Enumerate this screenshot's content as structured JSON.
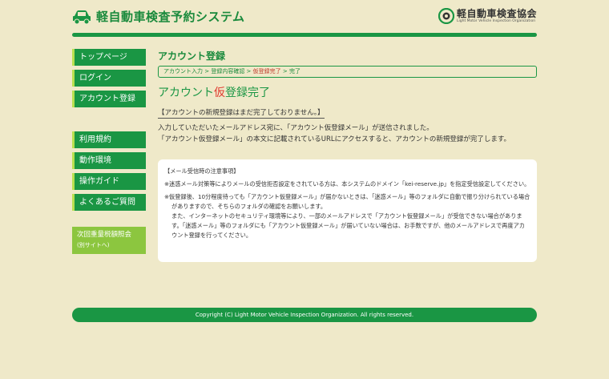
{
  "header": {
    "site_title": "軽自動車検査予約システム",
    "org_name": "軽自動車検査協会",
    "org_sub": "Light Motor Vehicle Inspection Organization"
  },
  "sidebar": {
    "primary": [
      {
        "label": "トップページ"
      },
      {
        "label": "ログイン"
      },
      {
        "label": "アカウント登録"
      }
    ],
    "secondary": [
      {
        "label": "利用規約"
      },
      {
        "label": "動作環境"
      },
      {
        "label": "操作ガイド"
      },
      {
        "label": "よくあるご質問"
      }
    ],
    "tax_link": {
      "label": "次回重量税額照会",
      "sub": "(別サイトへ)"
    }
  },
  "main": {
    "page_title": "アカウント登録",
    "breadcrumb": {
      "step1": "アカウント入力",
      "step2": "登録内容確認",
      "step3": "仮登録完了",
      "step4": "完了",
      "separator": " > "
    },
    "status_heading": {
      "pre": "アカウント",
      "kari": "仮",
      "post": "登録完了"
    },
    "notice": "【アカウントの新規登録はまだ完了しておりません。】",
    "body_line1": "入力していただいたメールアドレス宛に、「アカウント仮登録メール」が送信されました。",
    "body_line2": "「アカウント仮登録メール」の本文に記載されているURLにアクセスすると、アカウントの新規登録が完了します。",
    "info_box": {
      "title": "【メール受信時の注意事項】",
      "para1": "※迷惑メール対策等によりメールの受信拒否設定をされている方は、本システムのドメイン「kei-reserve.jp」を指定受信設定してください。",
      "para2": "※仮登録後、10分程度待っても「アカウント仮登録メール」が届かないときは、「迷惑メール」等のフォルダに自動で振り分けられている場合がありますので、そちらのフォルダの確認をお願いします。",
      "para3": "また、インターネットのセキュリティ環境等により、一部のメールアドレスで「アカウント仮登録メール」が受信できない場合があります。「迷惑メール」等のフォルダにも「アカウント仮登録メール」が届いていない場合は、お手数ですが、他のメールアドレスで再度アカウント登録を行ってください。"
    }
  },
  "footer": {
    "copyright": "Copyright (C) Light Motor Vehicle Inspection Organization. All rights reserved."
  },
  "colors": {
    "brand_green": "#1a9644",
    "accent_lime": "#8cc63f",
    "background": "#efe9c9",
    "highlight_red": "#e03a2e"
  },
  "icons": {
    "site": "car-icon",
    "org": "org-logo-icon"
  }
}
